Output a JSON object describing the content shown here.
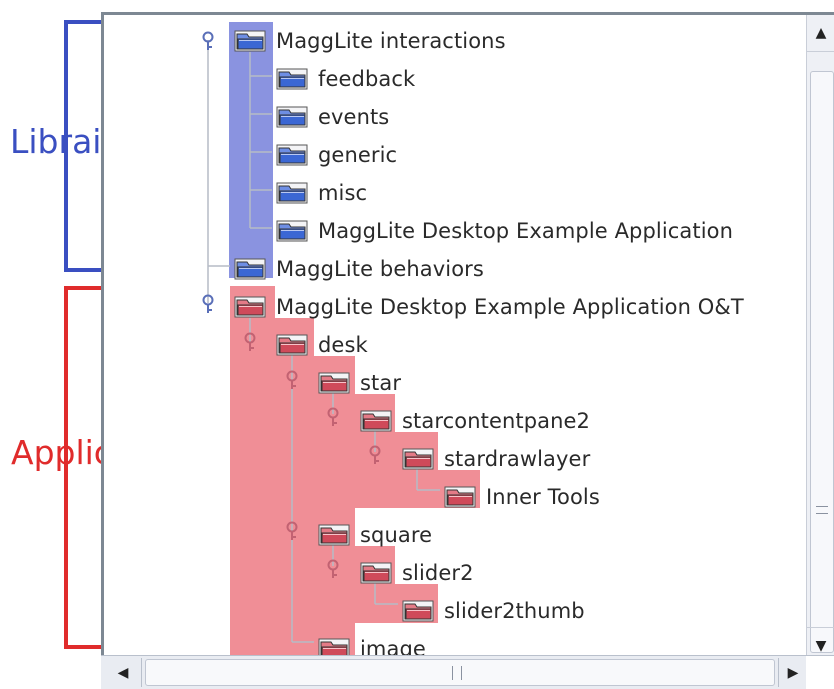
{
  "annotations": {
    "librairie": {
      "label": "Librairie",
      "color": "#3a4fc1"
    },
    "application": {
      "label": "Application",
      "color": "#e02b2b"
    }
  },
  "colors": {
    "library_highlight": "#8a93e0",
    "application_highlight": "#f08e96",
    "library_folder": "#3b67d4",
    "application_folder": "#cf4a5a",
    "tree_line": "#b6bcc6"
  },
  "tree": {
    "nodes": [
      {
        "label": "MaggLite interactions",
        "depth": 0,
        "group": "library",
        "expanded": true
      },
      {
        "label": "feedback",
        "depth": 1,
        "group": "library"
      },
      {
        "label": "events",
        "depth": 1,
        "group": "library"
      },
      {
        "label": "generic",
        "depth": 1,
        "group": "library"
      },
      {
        "label": "misc",
        "depth": 1,
        "group": "library"
      },
      {
        "label": "MaggLite Desktop Example Application",
        "depth": 1,
        "group": "library"
      },
      {
        "label": "MaggLite behaviors",
        "depth": 0,
        "group": "library"
      },
      {
        "label": "MaggLite Desktop Example Application O&T",
        "depth": 0,
        "group": "application",
        "expanded": true
      },
      {
        "label": "desk",
        "depth": 1,
        "group": "application",
        "expanded": true
      },
      {
        "label": "star",
        "depth": 2,
        "group": "application",
        "expanded": true
      },
      {
        "label": "starcontentpane2",
        "depth": 3,
        "group": "application",
        "expanded": true
      },
      {
        "label": "stardrawlayer",
        "depth": 4,
        "group": "application",
        "expanded": true
      },
      {
        "label": "Inner Tools",
        "depth": 5,
        "group": "application"
      },
      {
        "label": "square",
        "depth": 2,
        "group": "application",
        "expanded": true
      },
      {
        "label": "slider2",
        "depth": 3,
        "group": "application",
        "expanded": true
      },
      {
        "label": "slider2thumb",
        "depth": 4,
        "group": "application"
      },
      {
        "label": "image",
        "depth": 2,
        "group": "application"
      }
    ]
  },
  "scrollbars": {
    "vertical": {
      "up_icon": "scroll-up-arrow-icon",
      "down_icon": "scroll-down-arrow-icon",
      "grip_icon": "grip-icon"
    },
    "horizontal": {
      "left_icon": "scroll-left-arrow-icon",
      "right_icon": "scroll-right-arrow-icon",
      "grip_icon": "grip-icon"
    }
  }
}
